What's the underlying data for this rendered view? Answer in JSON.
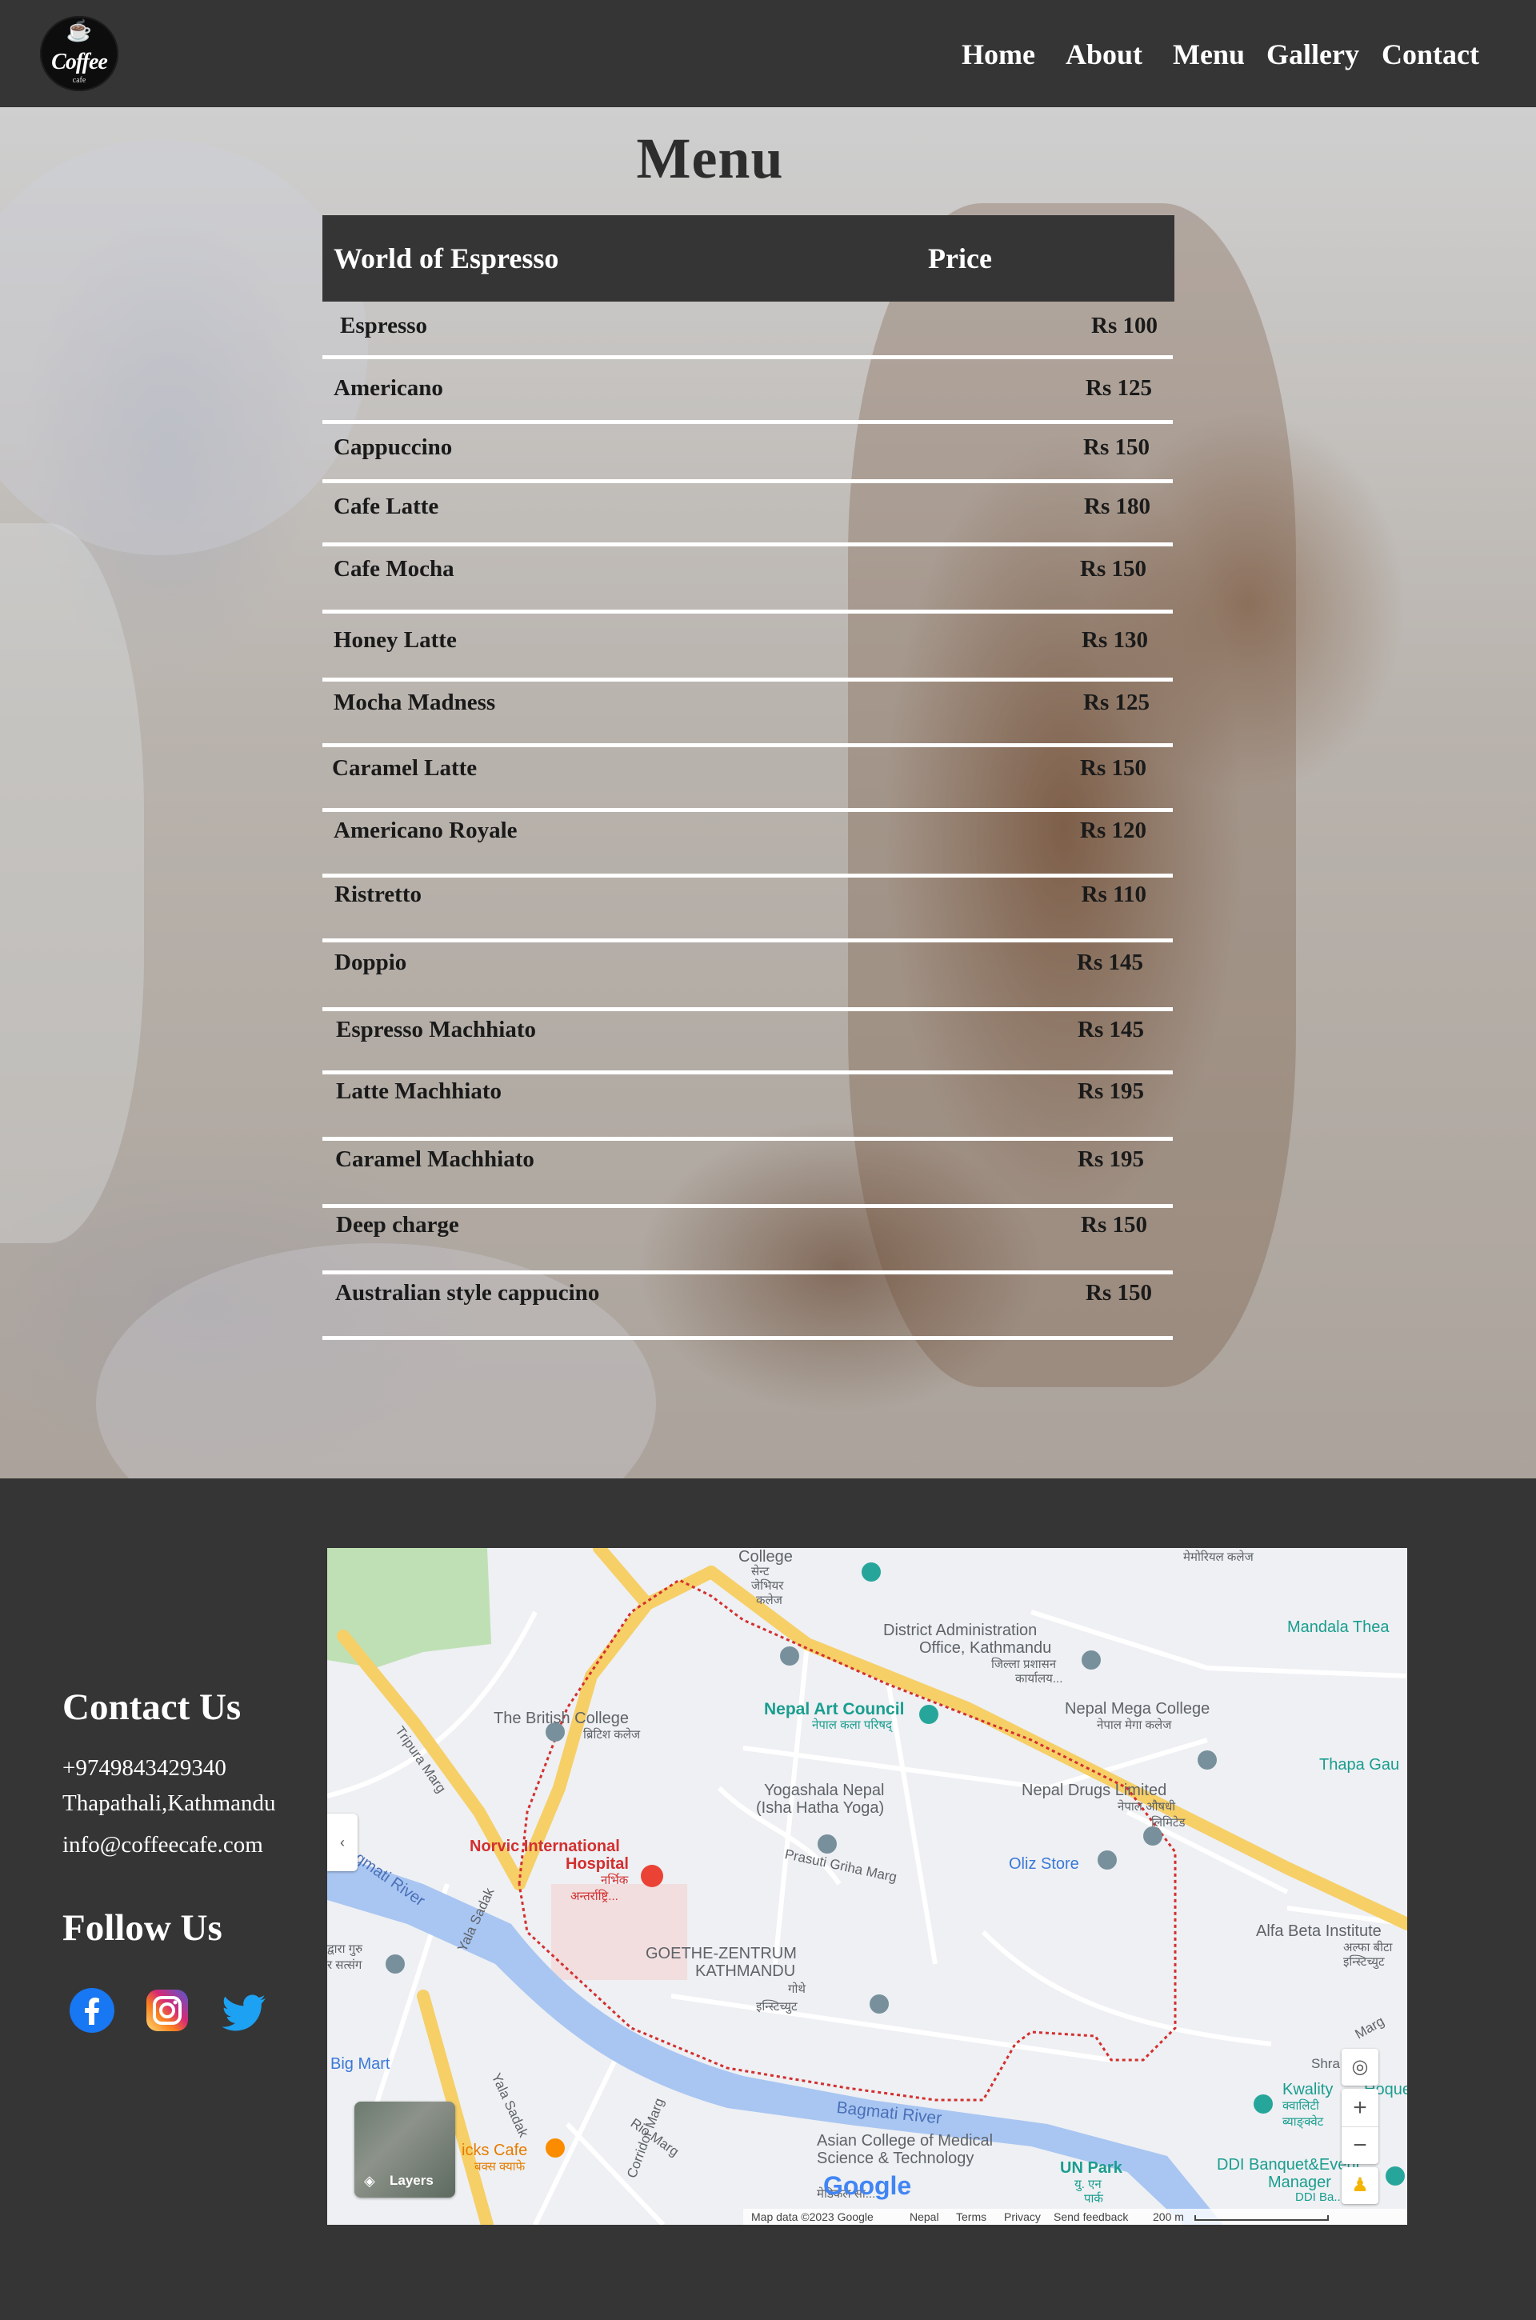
{
  "nav": {
    "logo": {
      "cup_glyph": "☕",
      "word": "Coffee",
      "sub": "cafe"
    },
    "links": [
      "Home",
      "About",
      "Menu",
      "Gallery",
      "Contact"
    ]
  },
  "menu": {
    "title": "Menu",
    "header": {
      "item": "World of Espresso",
      "price": "Price"
    },
    "items": [
      {
        "name": "Espresso",
        "price": "Rs 100"
      },
      {
        "name": "Americano",
        "price": "Rs 125"
      },
      {
        "name": "Cappuccino",
        "price": "Rs 150"
      },
      {
        "name": "Cafe Latte",
        "price": "Rs 180"
      },
      {
        "name": "Cafe Mocha",
        "price": "Rs 150"
      },
      {
        "name": "Honey Latte",
        "price": "Rs 130"
      },
      {
        "name": "Mocha Madness",
        "price": "Rs 125"
      },
      {
        "name": "Caramel Latte",
        "price": "Rs 150"
      },
      {
        "name": "Americano Royale",
        "price": "Rs 120"
      },
      {
        "name": "Ristretto",
        "price": "Rs 110"
      },
      {
        "name": "Doppio",
        "price": "Rs 145"
      },
      {
        "name": "Espresso Machhiato",
        "price": "Rs 145"
      },
      {
        "name": "Latte Machhiato",
        "price": "Rs 195"
      },
      {
        "name": "Caramel Machhiato",
        "price": "Rs 195"
      },
      {
        "name": "Deep charge",
        "price": "Rs 150"
      },
      {
        "name": "Australian style cappucino",
        "price": "Rs 150"
      }
    ]
  },
  "footer": {
    "contact_heading": "Contact Us",
    "phone": "+9749843429340",
    "address": "Thapathali,Kathmandu",
    "email": "info@coffeecafe.com",
    "follow_heading": "Follow Us",
    "social": [
      "facebook-icon",
      "instagram-icon",
      "twitter-icon"
    ]
  },
  "map": {
    "labels": {
      "college": "College",
      "college_np1": "सेन्ट",
      "college_np2": "जेभियर",
      "college_np3": "कलेज",
      "memorial": "मेमोरियल कलेज",
      "mandala": "Mandala Thea",
      "district1": "District Administration",
      "district2": "Office, Kathmandu",
      "district_np1": "जिल्ला प्रशासन",
      "district_np2": "कार्यालय...",
      "art_council": "Nepal Art Council",
      "art_council_np": "नेपाल कला परिषद्",
      "mega_college": "Nepal Mega College",
      "mega_college_np": "नेपाल मेगा कलेज",
      "thapa": "Thapa Gau",
      "british_college": "The British College",
      "british_college_np": "ब्रिटिश कलेज",
      "tripura": "Tripura Marg",
      "yogashala1": "Yogashala Nepal",
      "yogashala2": "(Isha Hatha Yoga)",
      "drugs": "Nepal Drugs Limited",
      "drugs_np1": "नेपाल औषधी",
      "drugs_np2": "लिमिटेड",
      "prasuti": "Prasuti Griha Marg",
      "oliz": "Oliz Store",
      "bagmati_top": "agmati River",
      "norvic1": "Norvic International",
      "norvic2": "Hospital",
      "norvic_np1": "नर्भिक",
      "norvic_np2": "अन्तर्राष्ट्रि...",
      "alfa": "Alfa Beta Institute",
      "alfa_np": "अल्फा बीटा",
      "alfa_np2": "इन्स्टिच्युट",
      "guru": "द्वारा गुरु",
      "guru2": "र सत्संग",
      "goethe1": "GOETHE-ZENTRUM",
      "goethe2": "KATHMANDU",
      "goethe_np1": "गोथे",
      "goethe_np2": "इन्स्टिच्युट",
      "yala1": "Yala Sadak",
      "yala2": "Yala Sadak",
      "big_mart": "Big Mart",
      "corridor": "Corridor Marg",
      "rio": "Rio Marg",
      "bagmati_bottom": "Bagmati River",
      "asian1": "Asian College of Medical",
      "asian2": "Science & Technology",
      "asian_np": "मेडिकल सा...",
      "un_park": "UN Park",
      "un_park_np1": "यु. एन",
      "un_park_np2": "पार्क",
      "kwality1": "Kwality",
      "kwality2": "Hoque",
      "kwality_np": "क्वालिटी",
      "kwality_np2": "ब्याङ्क्वेट",
      "ddi1": "DDI Banquet&Event",
      "ddi2": "Manager",
      "ddi3": "DDI Ba...",
      "icks": "icks Cafe",
      "icks_np": "बक्स क्याफे",
      "shra": "Shra",
      "marg": "Marg",
      "layers": "Layers",
      "google": "Google",
      "attribution": "Map data ©2023 Google",
      "nepal": "Nepal",
      "terms": "Terms",
      "privacy": "Privacy",
      "feedback": "Send feedback",
      "scale": "200 m"
    },
    "colors": {
      "road": "#f6cf67",
      "river": "#a9c6f2",
      "park": "#bfe0b5",
      "route": "#d32f2f"
    }
  }
}
